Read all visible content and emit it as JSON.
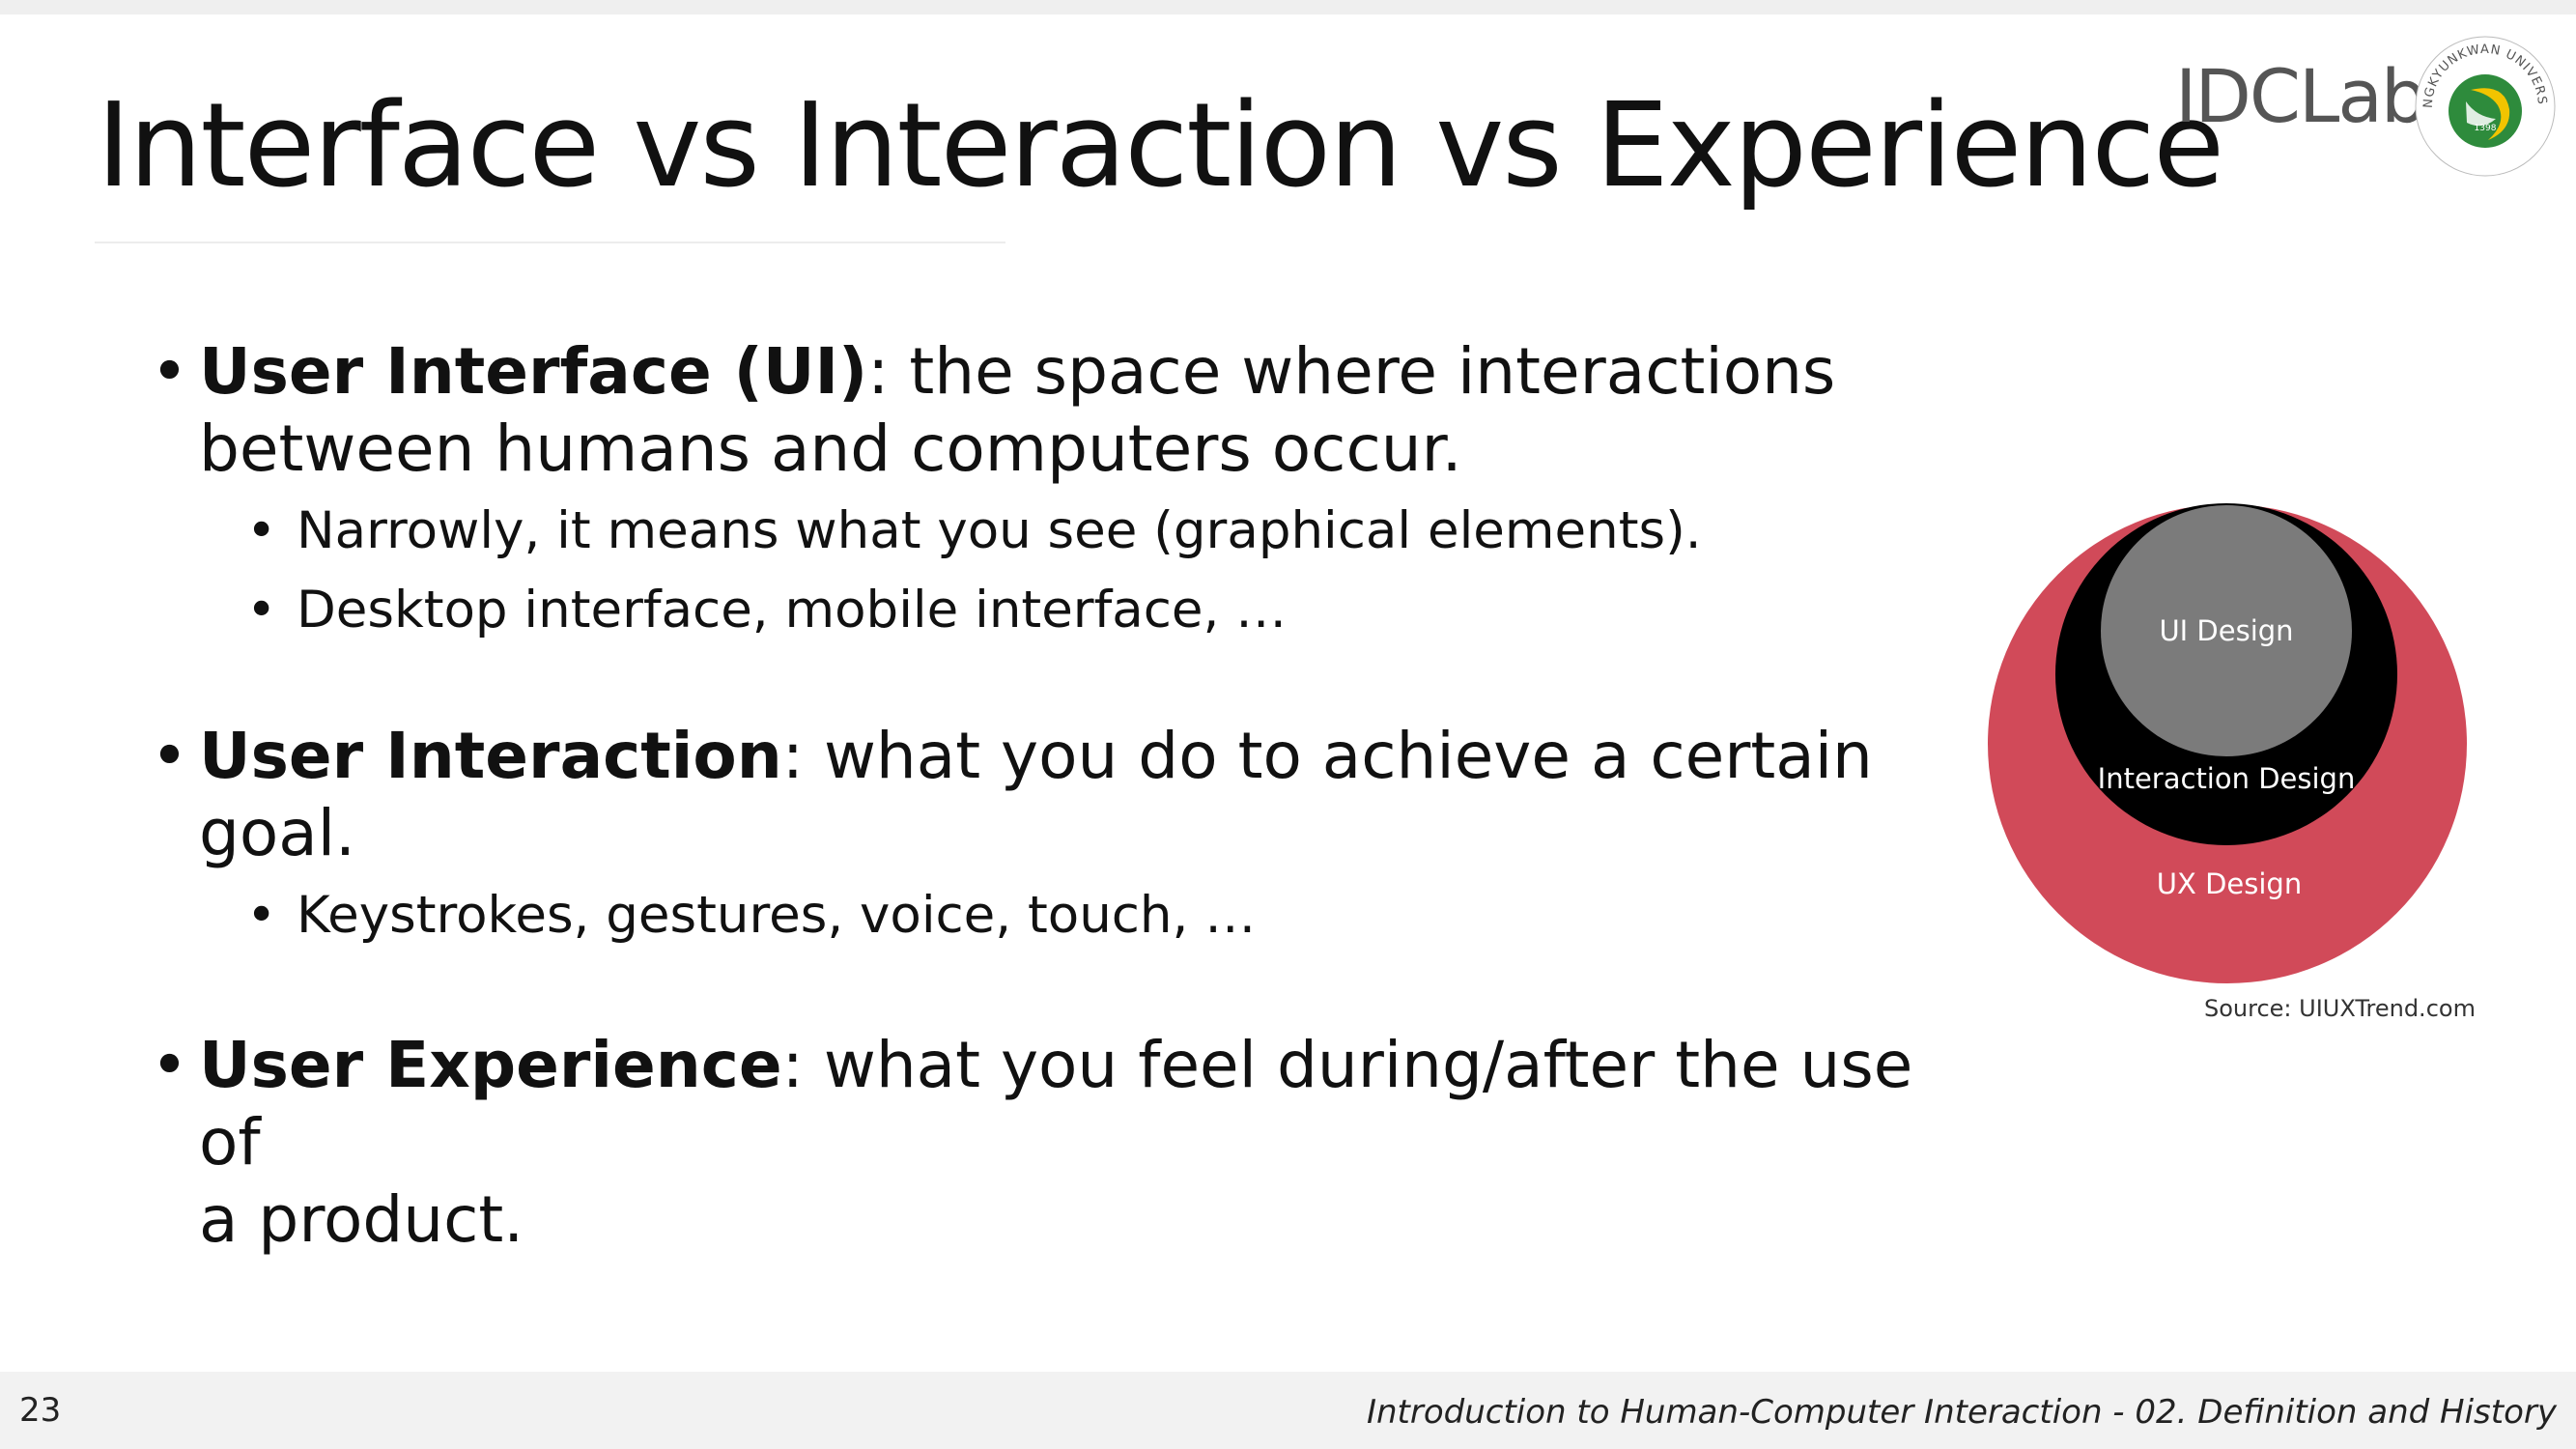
{
  "slide": {
    "title": "Interface vs Interaction vs Experience",
    "logo": {
      "lab_bold": "IDC",
      "lab_light": "Lab",
      "university": "SUNGKYUNKWAN UNIVERSITY",
      "seal_year": "1398"
    },
    "bullets": [
      {
        "term": "User Interface (UI)",
        "text_line1": ": the space where interactions",
        "text_line2": "between humans and computers occur.",
        "sub": [
          "Narrowly, it means what you see (graphical elements).",
          "Desktop interface, mobile interface, …"
        ]
      },
      {
        "term": "User Interaction",
        "text": ": what you do to achieve a certain goal.",
        "sub": [
          "Keystrokes, gestures, voice, touch, …"
        ]
      },
      {
        "term": "User Experience",
        "text_line1": ": what you feel during/after the use of",
        "text_line2": "a product."
      }
    ],
    "diagram": {
      "labels": {
        "inner": "UI Design",
        "middle": "Interaction Design",
        "outer": "UX Design"
      },
      "colors": {
        "outer": "#d14a59",
        "middle": "#000000",
        "inner": "#7b7b7b",
        "text": "#ffffff"
      },
      "source": "Source: UIUXTrend.com"
    },
    "bullet_char": "•"
  },
  "footer": {
    "page_number": "23",
    "course": "Introduction to Human-Computer Interaction - 02. Definition and History"
  }
}
